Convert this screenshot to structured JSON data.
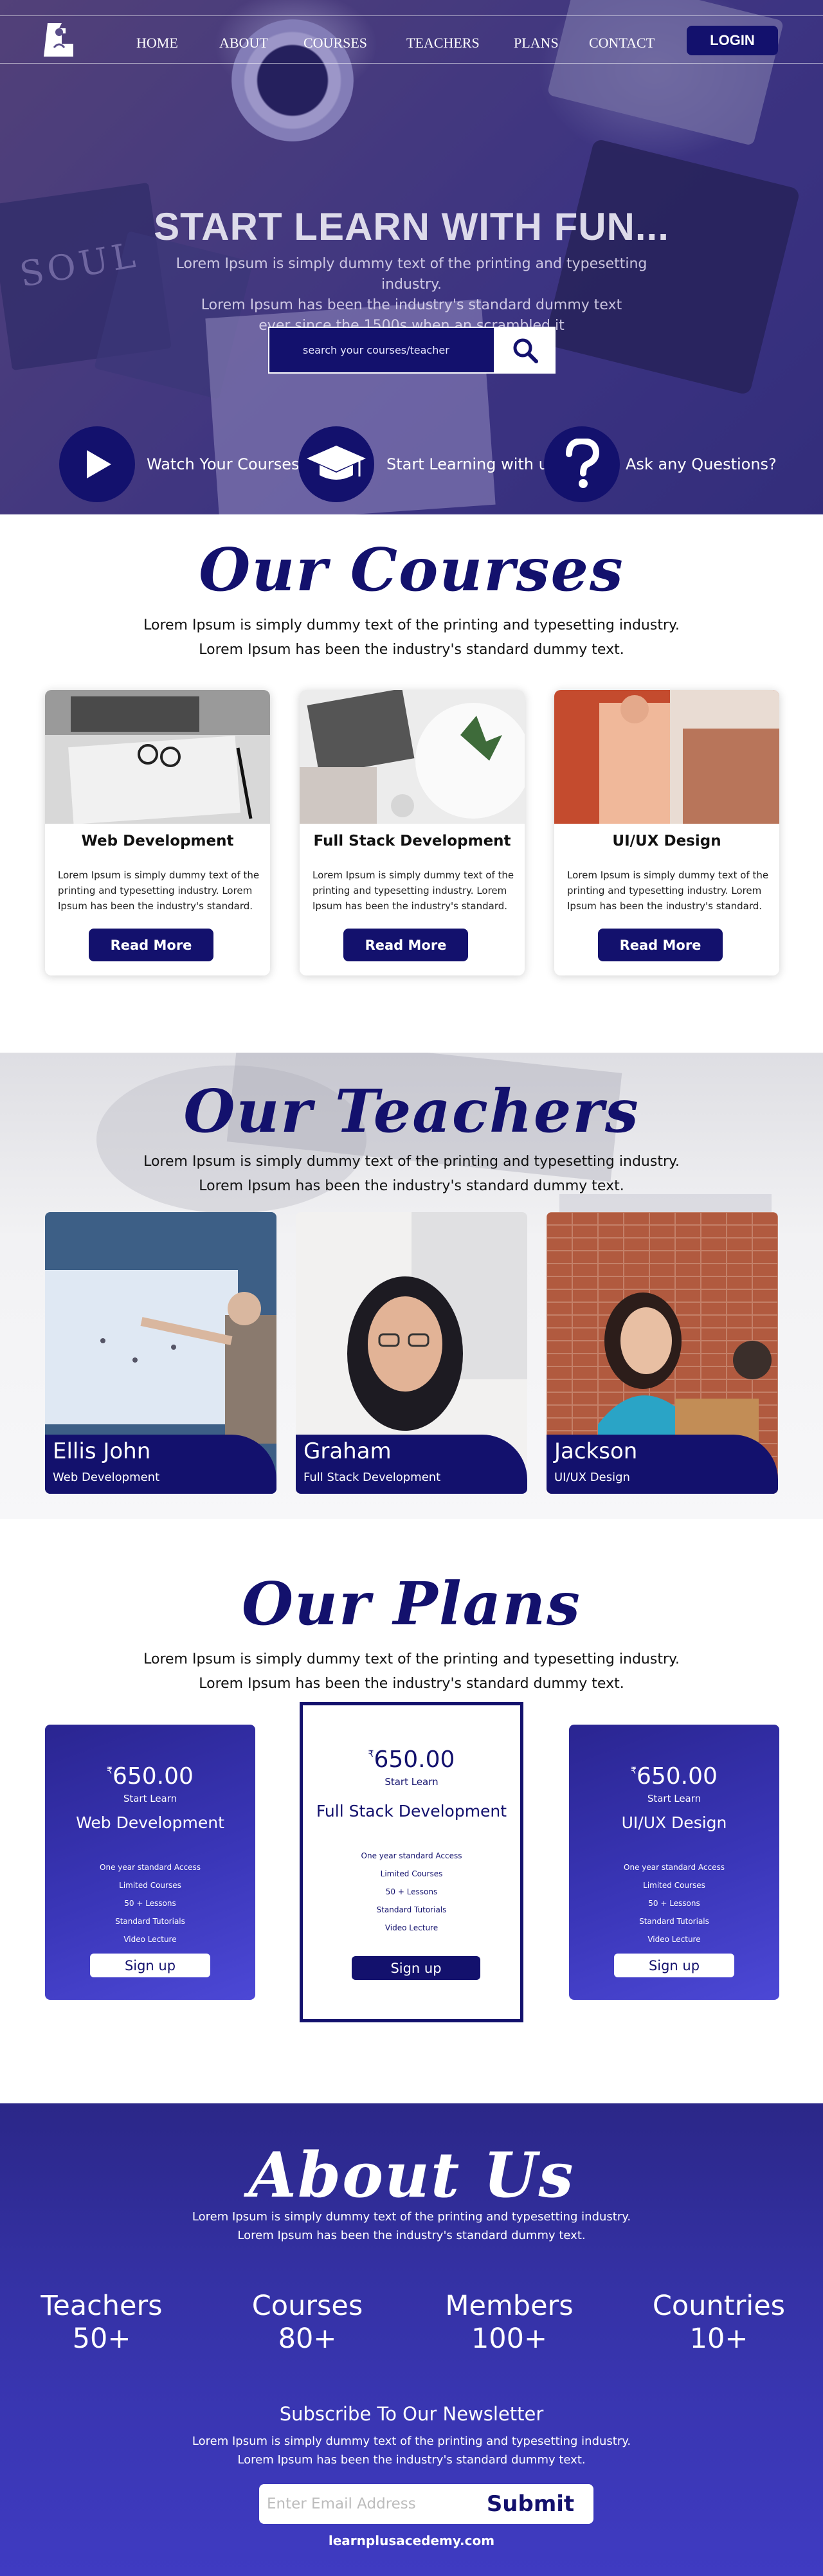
{
  "nav": {
    "items": [
      "HOME",
      "ABOUT",
      "COURSES",
      "TEACHERS",
      "PLANS",
      "CONTACT"
    ],
    "login": "LOGIN"
  },
  "hero": {
    "decor_text": "SOUL",
    "title": "START LEARN WITH FUN...",
    "subtitle_lines": [
      "Lorem Ipsum is simply dummy text of the printing and typesetting industry.",
      "Lorem Ipsum has been the industry's standard dummy text",
      "ever since the 1500s,when an scrambled it"
    ],
    "search_placeholder": "search your courses/teacher",
    "features": [
      {
        "icon": "play-icon",
        "label": "Watch Your Courses"
      },
      {
        "icon": "graduation-cap-icon",
        "label": "Start Learning with us"
      },
      {
        "icon": "question-mark-icon",
        "label": "Ask any Questions?"
      }
    ]
  },
  "courses": {
    "title": "Our Courses",
    "desc_lines": [
      "Lorem Ipsum is simply dummy text of the printing and typesetting industry.",
      "Lorem Ipsum has been the industry's standard dummy text."
    ],
    "items": [
      {
        "name": "Web Development",
        "desc": "Lorem Ipsum is simply dummy text of the printing and typesetting industry. Lorem Ipsum has been the industry's standard.",
        "button": "Read More"
      },
      {
        "name": "Full Stack Development",
        "desc": "Lorem Ipsum is simply dummy text of the printing and typesetting industry. Lorem Ipsum has been the industry's standard.",
        "button": "Read More"
      },
      {
        "name": "UI/UX Design",
        "desc": "Lorem Ipsum is simply dummy text of the printing and typesetting industry. Lorem Ipsum has been the industry's standard.",
        "button": "Read More"
      }
    ]
  },
  "teachers": {
    "title": "Our Teachers",
    "desc_lines": [
      "Lorem Ipsum is simply dummy text of the printing and typesetting industry.",
      "Lorem Ipsum has been the industry's standard dummy text."
    ],
    "items": [
      {
        "name": "Ellis John",
        "role": "Web Development"
      },
      {
        "name": "Graham",
        "role": "Full Stack Development"
      },
      {
        "name": "Jackson",
        "role": "UI/UX Design"
      }
    ]
  },
  "plans": {
    "title": "Our Plans",
    "desc_lines": [
      "Lorem Ipsum is simply dummy text of the printing and typesetting industry.",
      "Lorem Ipsum has been the industry's standard dummy text."
    ],
    "currency": "₹",
    "items": [
      {
        "price": "650.00",
        "start": "Start Learn",
        "name": "Web Development",
        "features": [
          "One year standard Access",
          "Limited Courses",
          "50 + Lessons",
          "Standard Tutorials",
          "Video Lecture"
        ],
        "button": "Sign up"
      },
      {
        "price": "650.00",
        "start": "Start Learn",
        "name": "Full Stack Development",
        "features": [
          "One year standard Access",
          "Limited Courses",
          "50 + Lessons",
          "Standard Tutorials",
          "Video Lecture"
        ],
        "button": "Sign up"
      },
      {
        "price": "650.00",
        "start": "Start Learn",
        "name": "UI/UX Design",
        "features": [
          "One year standard Access",
          "Limited Courses",
          "50 + Lessons",
          "Standard Tutorials",
          "Video Lecture"
        ],
        "button": "Sign up"
      }
    ]
  },
  "about": {
    "title": "About Us",
    "desc_lines": [
      "Lorem Ipsum is simply dummy text of the printing and typesetting industry.",
      "Lorem Ipsum has been the industry's standard dummy text."
    ],
    "stats": [
      {
        "label": "Teachers",
        "value": "50+"
      },
      {
        "label": "Courses",
        "value": "80+"
      },
      {
        "label": "Members",
        "value": "100+"
      },
      {
        "label": "Countries",
        "value": "10+"
      }
    ],
    "newsletter_title": "Subscribe To Our Newsletter",
    "newsletter_desc_lines": [
      "Lorem Ipsum is simply dummy text of the printing and typesetting industry.",
      "Lorem Ipsum has been the industry's standard dummy text."
    ],
    "email_placeholder": "Enter Email Address",
    "submit": "Submit",
    "footer_url": "learnplusacedemy.com"
  },
  "colors": {
    "brand": "#13116d",
    "brand_light": "#3f3bc2"
  }
}
